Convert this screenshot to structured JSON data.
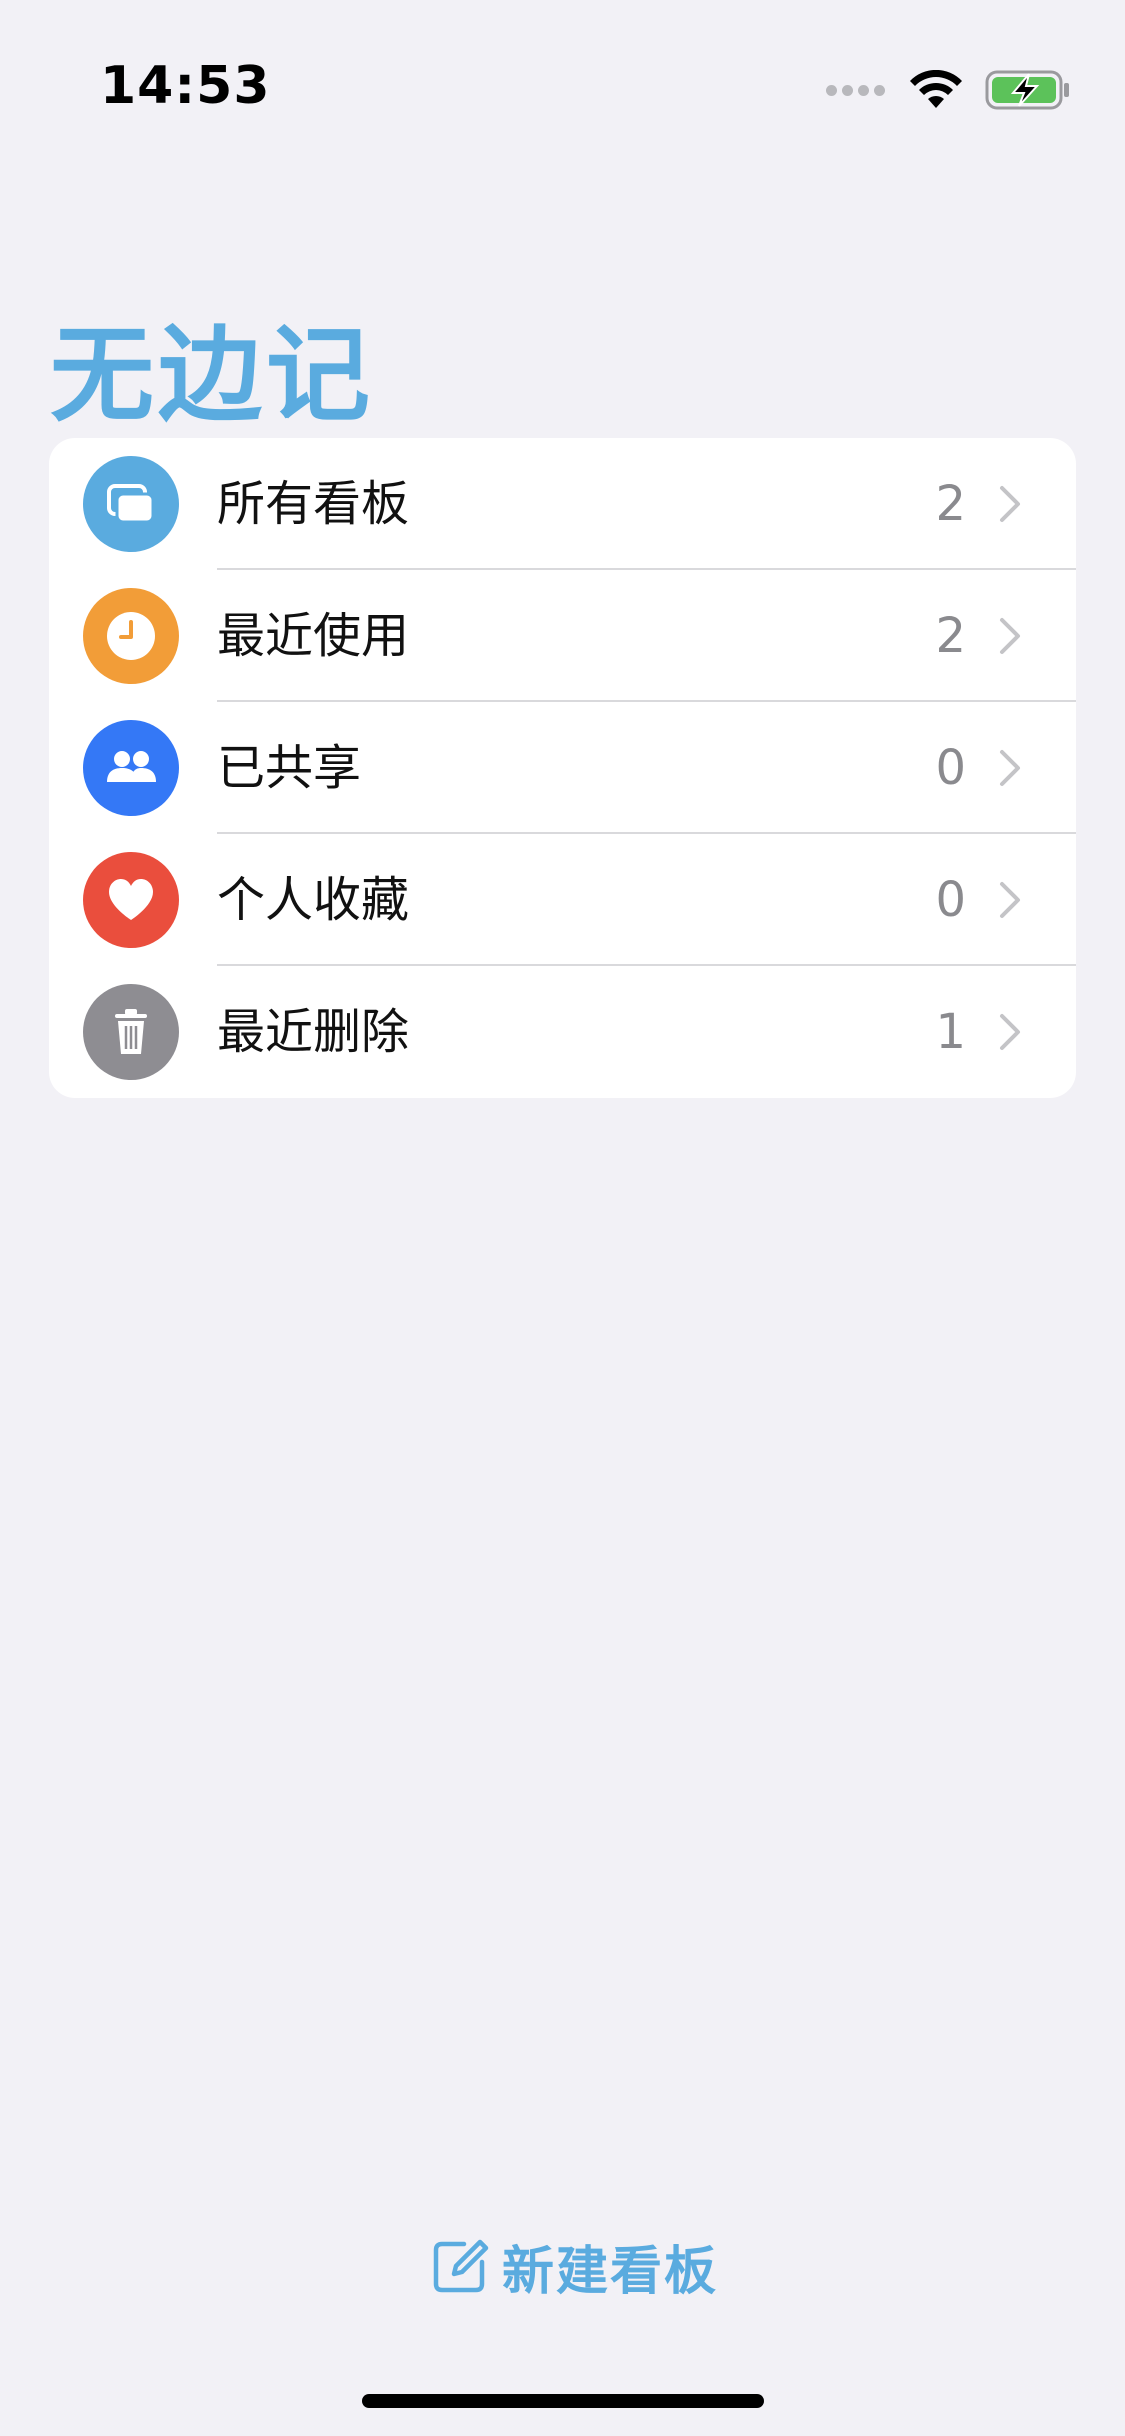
{
  "status_bar": {
    "time": "14:53"
  },
  "header": {
    "title": "无边记"
  },
  "colors": {
    "accent": "#5aabdf",
    "all_boards": "#5aabdf",
    "recent": "#f29d38",
    "shared": "#3478f6",
    "favorites": "#ea4e3d",
    "deleted": "#8e8d92"
  },
  "list": {
    "items": [
      {
        "label": "所有看板",
        "count": "2",
        "icon": "boards-icon"
      },
      {
        "label": "最近使用",
        "count": "2",
        "icon": "clock-icon"
      },
      {
        "label": "已共享",
        "count": "0",
        "icon": "people-icon"
      },
      {
        "label": "个人收藏",
        "count": "0",
        "icon": "heart-icon"
      },
      {
        "label": "最近删除",
        "count": "1",
        "icon": "trash-icon"
      }
    ]
  },
  "footer": {
    "new_board_label": "新建看板",
    "new_board_icon": "compose-icon"
  }
}
